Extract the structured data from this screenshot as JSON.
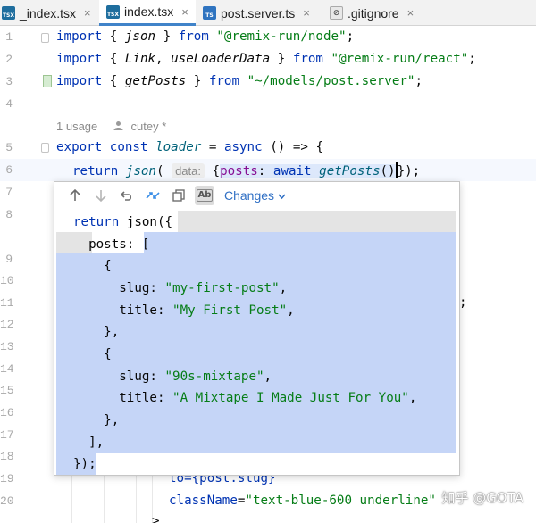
{
  "tabs": [
    {
      "icon": "TSX",
      "label": "_index.tsx",
      "active": false
    },
    {
      "icon": "TSX",
      "label": "index.tsx",
      "active": true
    },
    {
      "icon": "TS",
      "label": "post.server.ts",
      "active": false
    },
    {
      "icon": "⊘",
      "label": ".gitignore",
      "active": false
    }
  ],
  "tab_close_glyph": "×",
  "line_numbers": [
    "1",
    "2",
    "3",
    "4",
    "5",
    "6",
    "7",
    "8",
    "9",
    "10",
    "11",
    "12",
    "13",
    "14",
    "15",
    "16",
    "17",
    "18",
    "19",
    "20"
  ],
  "code": {
    "l1": {
      "kw": "import",
      "a": " { ",
      "id": "json",
      "b": " } ",
      "from": "from",
      "sp": " ",
      "str": "\"@remix-run/node\"",
      "end": ";"
    },
    "l2": {
      "kw": "import",
      "a": " { ",
      "id1": "Link",
      "c": ", ",
      "id2": "useLoaderData",
      "b": " } ",
      "from": "from",
      "sp": " ",
      "str": "\"@remix-run/react\"",
      "end": ";"
    },
    "l3": {
      "kw": "import",
      "a": " { ",
      "id": "getPosts",
      "b": " } ",
      "from": "from",
      "sp": " ",
      "str": "\"~/models/post.server\"",
      "end": ";"
    },
    "usage": {
      "count": "1 usage",
      "author": "cutey *"
    },
    "l5": {
      "kw1": "export",
      "kw2": "const",
      "fn": "loader",
      "eq": " = ",
      "kw3": "async",
      "rest": " () => {"
    },
    "l6": {
      "ret": "return",
      "fn": "json",
      "paren": "(",
      "hint": "data:",
      "brace": "{",
      "prop": "posts",
      "colon": ": ",
      "aw": "await",
      "call": "getPosts",
      "parens": "()",
      "close": "});"
    },
    "bg_semicolon": ";",
    "bg_to": "to={post.slug}",
    "bg_class_attr": "className",
    "bg_class_eq": "=",
    "bg_class_val": "\"text-blue-600 underli",
    "bg_class_tail": "ne\"",
    "bg_gt": ">"
  },
  "diff_popup": {
    "toolbar_icons": [
      "arrow-up-icon",
      "arrow-down-icon",
      "undo-icon",
      "compare-icon",
      "copy-icon",
      "whitespace-icon"
    ],
    "changes_label": "Changes",
    "lines": [
      {
        "t1": "return",
        "t2": " json({"
      },
      {
        "t1": "  posts: ["
      },
      {
        "t1": "    {"
      },
      {
        "t1": "      slug: ",
        "s": "\"my-first-post\"",
        "e": ","
      },
      {
        "t1": "      title: ",
        "s": "\"My First Post\"",
        "e": ","
      },
      {
        "t1": "    },"
      },
      {
        "t1": "    {"
      },
      {
        "t1": "      slug: ",
        "s": "\"90s-mixtape\"",
        "e": ","
      },
      {
        "t1": "      title: ",
        "s": "\"A Mixtape I Made Just For You\"",
        "e": ","
      },
      {
        "t1": "    },"
      },
      {
        "t1": "  ],"
      },
      {
        "t1": "});"
      }
    ]
  },
  "watermark": "知乎 @GOTA",
  "colors": {
    "keyword": "#0033b3",
    "string": "#067d17",
    "function": "#00627a",
    "diff_bg": "#c5d5f7",
    "accent": "#4083c9"
  }
}
